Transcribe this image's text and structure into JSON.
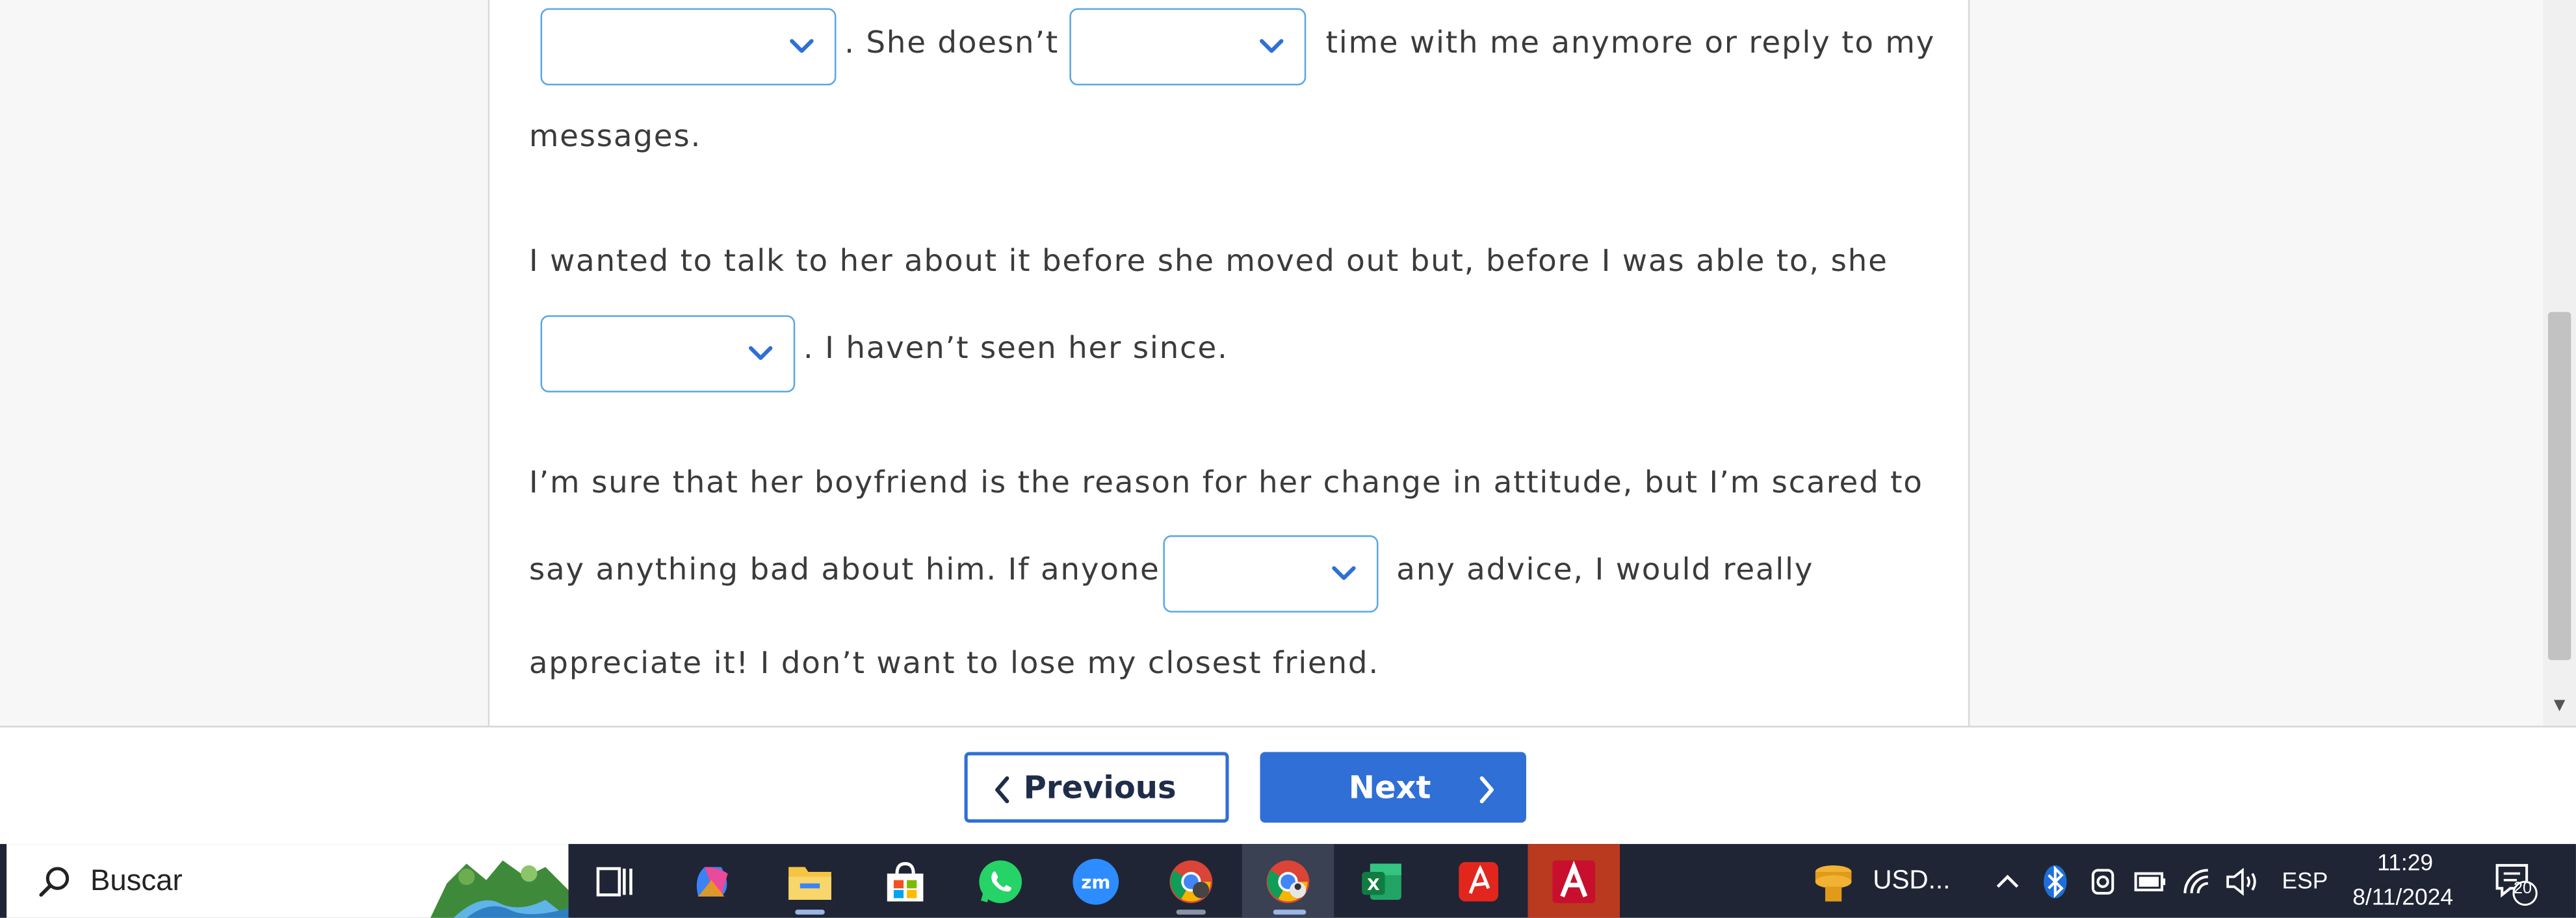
{
  "paragraphs": {
    "p1_line1_a": ". She doesn’t",
    "p1_line1_b": "time with me anymore or reply to my",
    "p1_line2": "messages.",
    "p2_line1": "I wanted to talk to her about it before she moved out but, before I was able to, she",
    "p2_line2": ". I haven’t seen her since.",
    "p3_line1": "I’m sure that her boyfriend is the reason for her change in attitude, but I’m scared to",
    "p3_line2_a": "say anything bad about him. If anyone",
    "p3_line2_b": "any advice, I would really",
    "p3_line3": "appreciate it! I don’t want to lose my closest friend."
  },
  "dropdowns": [
    {
      "id": "blank-1",
      "value": ""
    },
    {
      "id": "blank-2",
      "value": ""
    },
    {
      "id": "blank-3",
      "value": ""
    },
    {
      "id": "blank-4",
      "value": ""
    }
  ],
  "navigation": {
    "previous_label": "Previous",
    "next_label": "Next"
  },
  "taskbar": {
    "search_label": "Buscar",
    "apps": [
      "task-view-icon",
      "copilot-icon",
      "file-explorer-icon",
      "microsoft-store-icon",
      "whatsapp-icon",
      "zoom-icon",
      "chrome-icon",
      "chrome-profile-icon",
      "excel-icon",
      "acrobat-icon",
      "autocad-icon"
    ],
    "currency_widget": "USD...",
    "language": "ESP",
    "time": "11:29",
    "date": "8/11/2024",
    "notification_count": "20"
  },
  "colors": {
    "accent": "#2f6fd6",
    "dropdown_border": "#5aa7e6",
    "taskbar": "#1f2535",
    "text": "#3b3b3b"
  }
}
